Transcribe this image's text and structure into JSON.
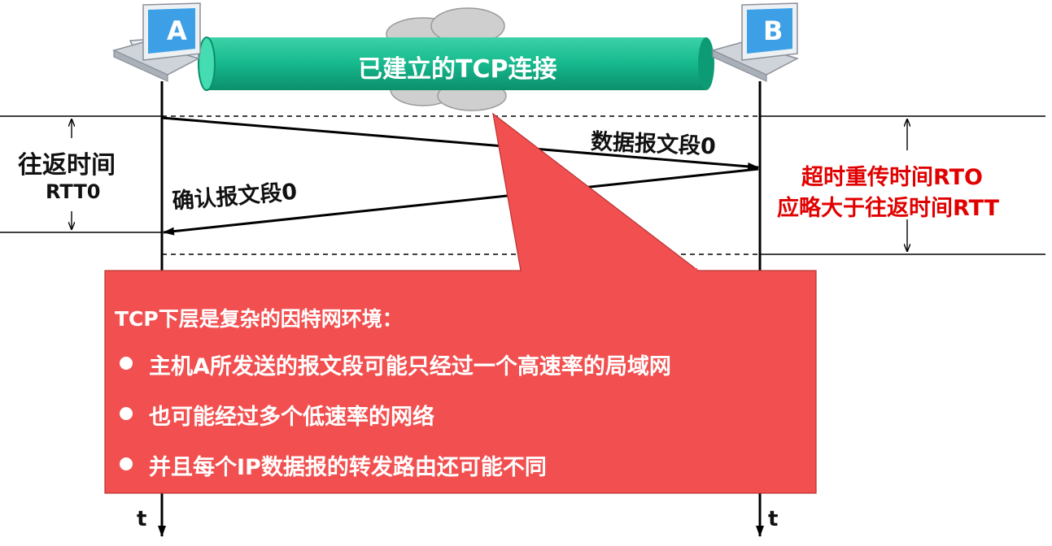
{
  "connection": {
    "label": "已建立的TCP连接"
  },
  "hosts": [
    {
      "letter": "A",
      "timeline_label": "t"
    },
    {
      "letter": "B",
      "timeline_label": "t"
    }
  ],
  "segments": {
    "data": "数据报文段0",
    "ack": "确认报文段0"
  },
  "rtt": {
    "title": "往返时间",
    "value": "RTT0"
  },
  "rto": {
    "line1": "超时重传时间RTO",
    "line2": "应略大于往返时间RTT"
  },
  "callout": {
    "heading": "TCP下层是复杂的因特网环境：",
    "bullets": [
      "主机A所发送的报文段可能只经过一个高速率的局域网",
      "也可能经过多个低速率的网络",
      "并且每个IP数据报的转发路由还可能不同"
    ]
  },
  "colors": {
    "tube": "#19b98e",
    "callout": "#f25050",
    "rto_text": "#e00000",
    "host_badge": "#3da0e6"
  }
}
